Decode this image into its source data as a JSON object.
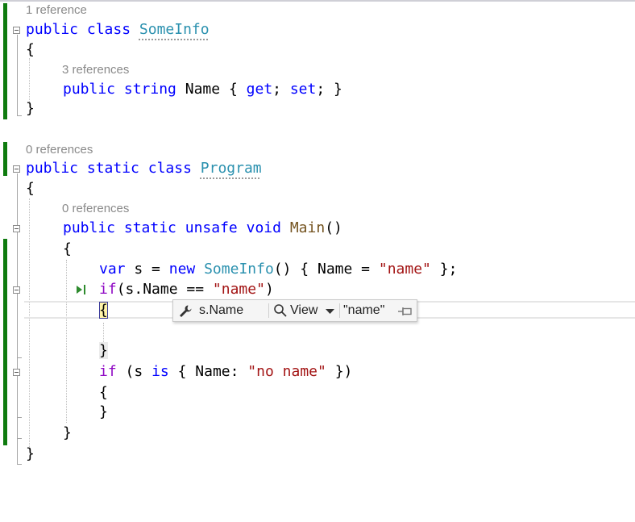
{
  "lens": {
    "some_info": "1 reference",
    "name_prop": "3 references",
    "program": "0 references",
    "main": "0 references"
  },
  "code": {
    "l1": {
      "kw1": "public",
      "kw2": "class",
      "cls": "SomeInfo"
    },
    "open_brace": "{",
    "close_brace": "}",
    "l4": {
      "kw1": "public",
      "kw2": "string",
      "name": "Name",
      "b1": "{",
      "get": "get",
      "semi1": ";",
      "set": "set",
      "semi2": ";",
      "b2": "}"
    },
    "l6": {
      "kw1": "public",
      "kw2": "static",
      "kw3": "class",
      "cls": "Program"
    },
    "l8": {
      "kw1": "public",
      "kw2": "static",
      "kw3": "unsafe",
      "kw4": "void",
      "meth": "Main",
      "parens": "()"
    },
    "l10": {
      "var": "var",
      "rest1": "s",
      "eq": "=",
      "new": "new",
      "cls": "SomeInfo",
      "rest2": "() { Name =",
      "str": "\"name\"",
      "rest3": "};"
    },
    "l11": {
      "if": "if",
      "rest1": "(s.Name ==",
      "str": "\"name\"",
      "rest2": ")"
    },
    "l15": {
      "if": "if",
      "rest1": "(s",
      "is": "is",
      "rest2": "{ Name:",
      "str": "\"no name\"",
      "rest3": "})"
    }
  },
  "datatip": {
    "expression": "s.Name",
    "view_label": "View",
    "value": "\"name\""
  },
  "colors": {
    "keyword": "#0000ff",
    "type": "#2b91af",
    "string": "#a31515",
    "method": "#74531f",
    "control": "#8f08c4",
    "changed_bar": "#0f7b0f"
  }
}
